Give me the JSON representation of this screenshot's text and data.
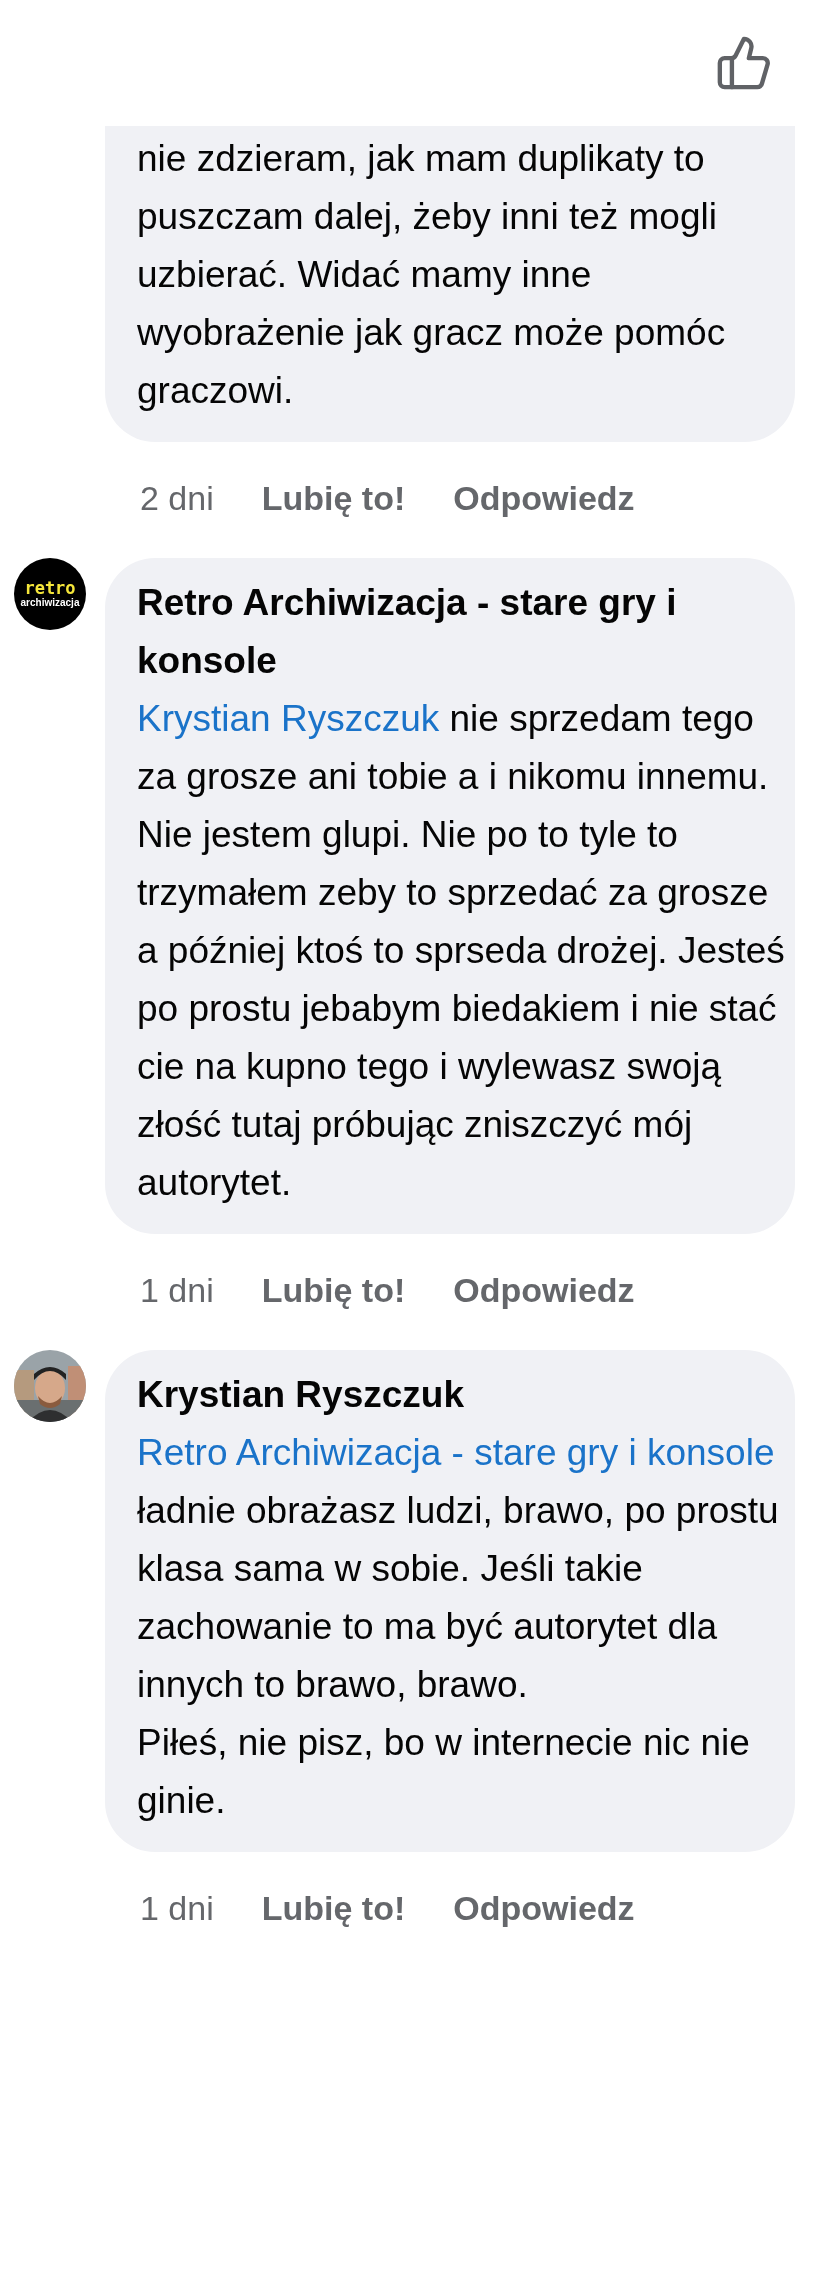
{
  "comments": [
    {
      "kind": "continued",
      "paragraphs": [
        {
          "text": "nie zdzieram, jak mam duplikaty to puszczam dalej, żeby inni też mogli uzbierać. Widać mamy inne wyobrażenie jak gracz może pomóc graczowi."
        }
      ],
      "time": "2 dni",
      "like": "Lubię to!",
      "reply": "Odpowiedz"
    },
    {
      "kind": "logo",
      "author": "Retro Archiwizacja - stare gry i konsole",
      "avatar_lines": [
        "retro",
        "archiwizacja"
      ],
      "paragraphs": [
        {
          "mention": "Krystian Ryszczuk",
          "text": "nie sprzedam tego za grosze ani tobie a i nikomu innemu. Nie jestem glupi. Nie po to tyle to trzymałem zeby to sprzedać za grosze a później ktoś to sprseda drożej. Jesteś po prostu jebabym biedakiem i nie stać cie na kupno tego i wylewasz swoją złość tutaj próbując zniszczyć mój autorytet."
        }
      ],
      "time": "1 dni",
      "like": "Lubię to!",
      "reply": "Odpowiedz"
    },
    {
      "kind": "picture",
      "author": "Krystian Ryszczuk",
      "paragraphs": [
        {
          "mention": "Retro Archiwizacja - stare gry i konsole",
          "text": "ładnie obrażasz ludzi, brawo, po prostu klasa sama w sobie. Jeśli takie zachowanie to ma być autorytet dla innych to brawo, brawo."
        },
        {
          "text": "Piłeś, nie pisz, bo w internecie nic nie ginie."
        }
      ],
      "time": "1 dni",
      "like": "Lubię to!",
      "reply": "Odpowiedz"
    }
  ]
}
